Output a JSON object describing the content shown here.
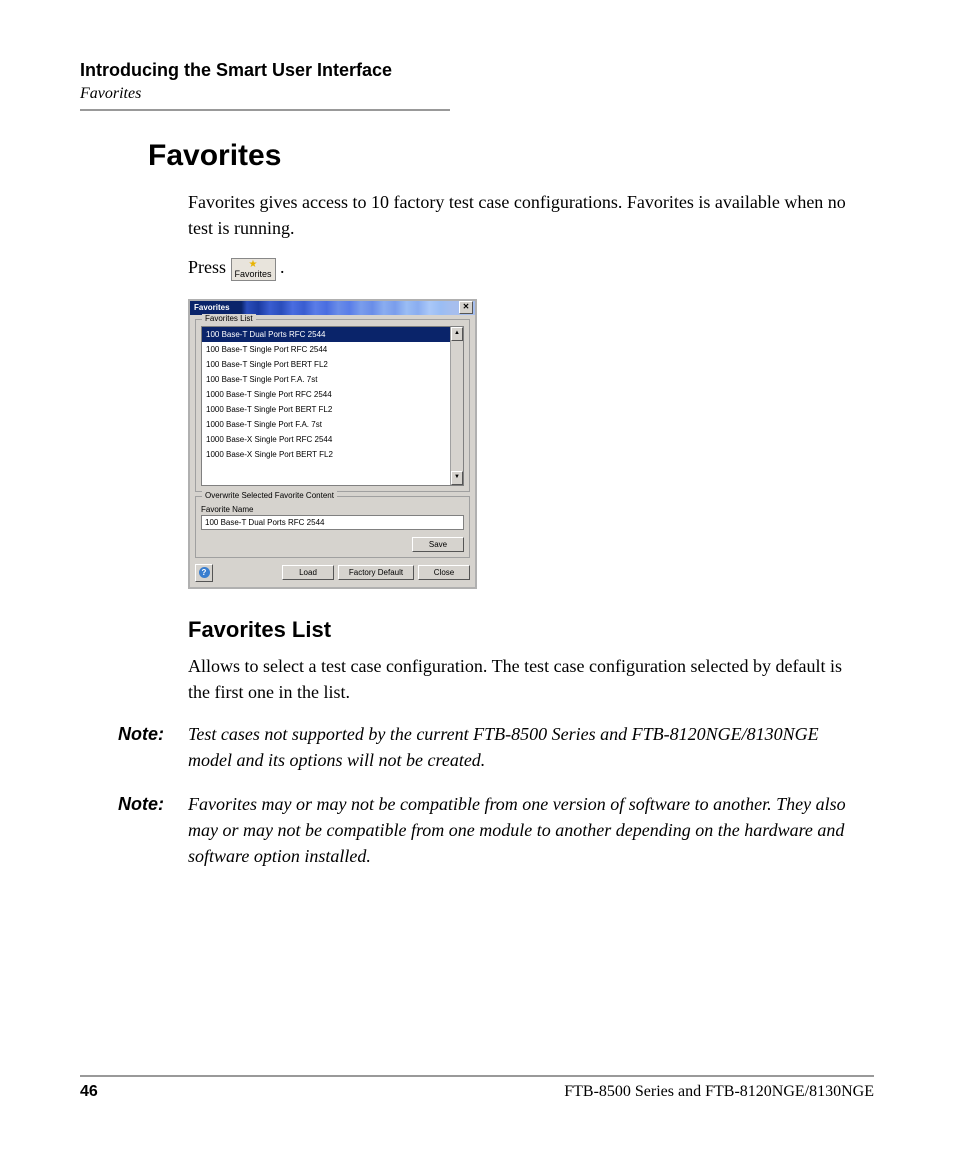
{
  "header": {
    "title": "Introducing the Smart User Interface",
    "subtitle": "Favorites"
  },
  "section_heading": "Favorites",
  "intro": "Favorites gives access to 10 factory test case configurations. Favorites is available when no test is running.",
  "press_label": "Press",
  "press_button_caption": "Favorites",
  "period": ".",
  "dialog": {
    "title": "Favorites",
    "list_group": "Favorites List",
    "items": [
      "100 Base-T Dual Ports RFC 2544",
      "100 Base-T Single Port RFC 2544",
      "100 Base-T Single Port BERT FL2",
      "100 Base-T Single Port F.A. 7st",
      "1000 Base-T Single Port RFC 2544",
      "1000 Base-T Single Port BERT FL2",
      "1000 Base-T Single Port F.A. 7st",
      "1000 Base-X Single Port RFC 2544",
      "1000 Base-X Single Port BERT FL2"
    ],
    "overwrite_group": "Overwrite Selected Favorite Content",
    "fav_name_label": "Favorite Name",
    "fav_name_value": "100 Base-T Dual Ports RFC 2544",
    "save": "Save",
    "load": "Load",
    "factory_default": "Factory Default",
    "close": "Close",
    "help": "?"
  },
  "subsection_heading": "Favorites List",
  "subsection_body": "Allows to select a test case configuration. The test case configuration selected by default is the first one in the list.",
  "notes": [
    {
      "label": "Note:",
      "text": "Test cases not supported by the current FTB-8500 Series and FTB-8120NGE/8130NGE model and its options will not be created."
    },
    {
      "label": "Note:",
      "text": "Favorites may or may not be compatible from one version of software to another. They also may or may not be compatible from one module to another depending on the hardware and software option installed."
    }
  ],
  "footer": {
    "page": "46",
    "doc": "FTB-8500 Series and FTB-8120NGE/8130NGE"
  }
}
